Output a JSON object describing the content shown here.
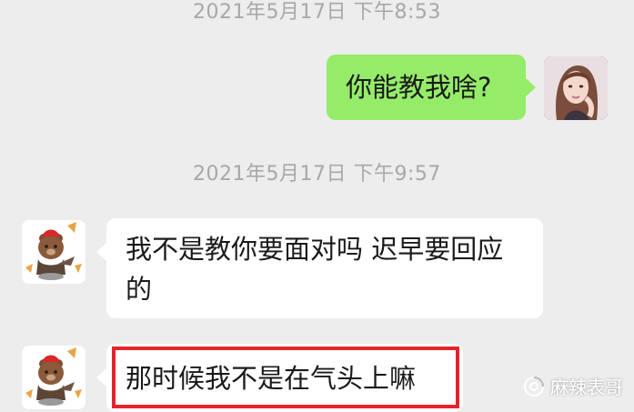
{
  "timestamps": [
    "2021年5月17日 下午8:53",
    "2021年5月17日 下午9:57"
  ],
  "messages": [
    {
      "side": "right",
      "text": "你能教我啥?",
      "avatar_icon": "woman-avatar-icon"
    },
    {
      "side": "left",
      "text_line1": "我不是教你要面对吗 迟早要回应",
      "text_line2": "的",
      "avatar_icon": "bear-avatar-icon"
    },
    {
      "side": "left",
      "text": "那时候我不是在气头上嘛",
      "avatar_icon": "bear-avatar-icon",
      "highlighted": true
    }
  ],
  "watermark": {
    "text": "麻辣表哥",
    "icon": "wechat-official-account-icon"
  },
  "colors": {
    "background": "#ededed",
    "bubble_sent": "#95ec69",
    "bubble_received": "#ffffff",
    "highlight_border": "#e8222a",
    "timestamp": "#a8a8a8"
  }
}
